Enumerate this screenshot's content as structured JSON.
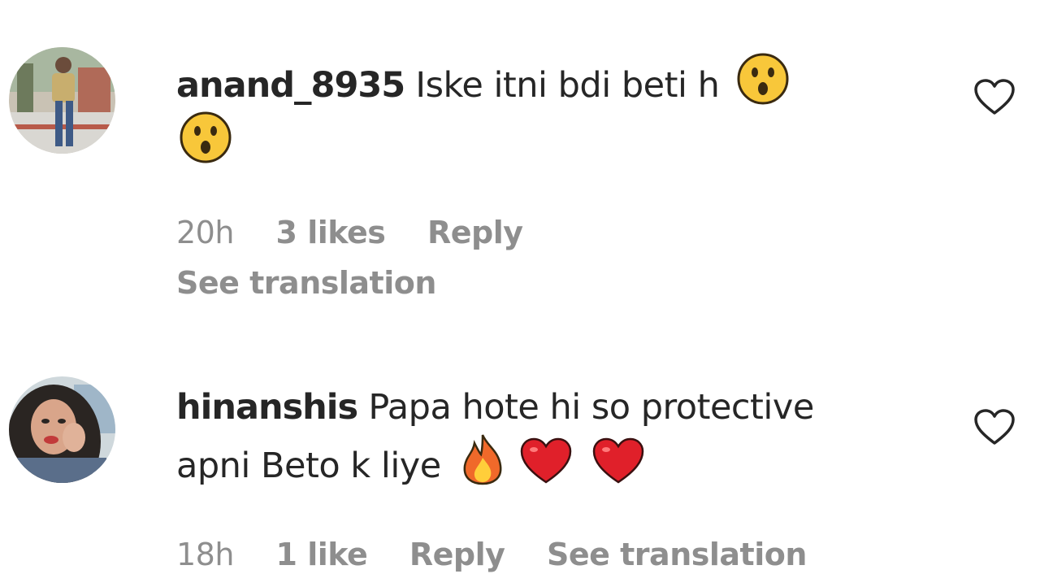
{
  "comments": [
    {
      "username": "anand_8935",
      "text": "Iske itni bdi beti h",
      "emojis_line1": [
        "astonished-face"
      ],
      "emojis_line2": [
        "astonished-face"
      ],
      "time": "20h",
      "likes": "3 likes",
      "reply": "Reply",
      "translation": "See translation"
    },
    {
      "username": "hinanshis",
      "text": "Papa hote hi so protective",
      "text_line2": "apni Beto k liye",
      "emojis_line2": [
        "fire",
        "red-heart",
        "red-heart"
      ],
      "time": "18h",
      "likes": "1 like",
      "reply": "Reply",
      "translation": "See translation"
    }
  ],
  "icons": {
    "like": "heart-outline-icon"
  },
  "colors": {
    "text": "#262626",
    "meta": "#8e8e8e"
  }
}
